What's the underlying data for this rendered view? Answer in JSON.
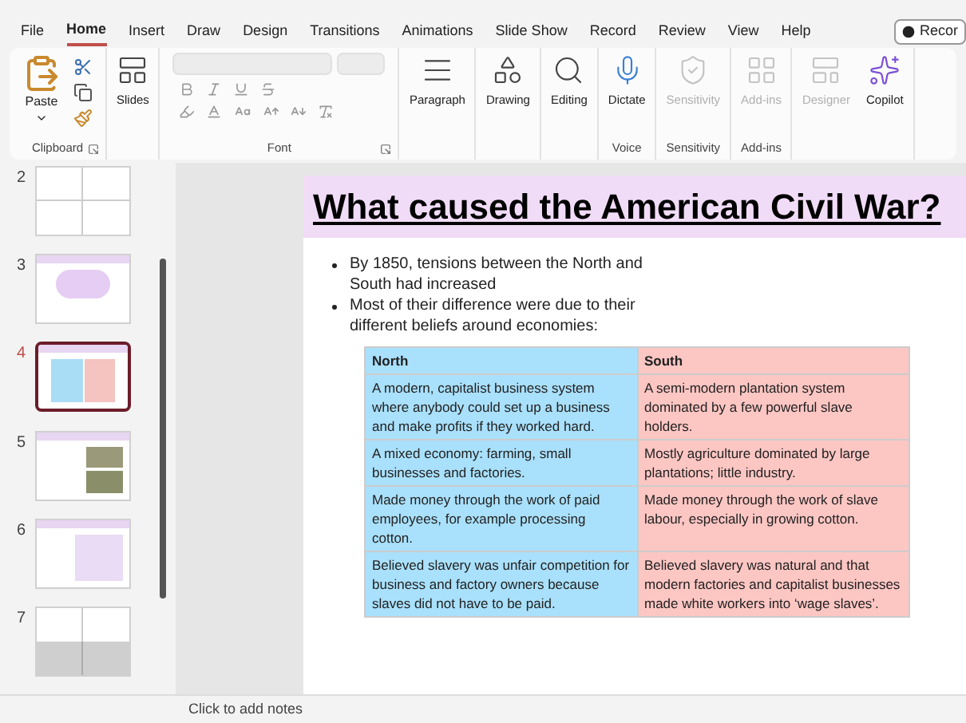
{
  "menu_tabs": [
    {
      "label": "File",
      "selected": false
    },
    {
      "label": "Home",
      "selected": true
    },
    {
      "label": "Insert",
      "selected": false
    },
    {
      "label": "Draw",
      "selected": false
    },
    {
      "label": "Design",
      "selected": false
    },
    {
      "label": "Transitions",
      "selected": false
    },
    {
      "label": "Animations",
      "selected": false
    },
    {
      "label": "Slide Show",
      "selected": false
    },
    {
      "label": "Record",
      "selected": false
    },
    {
      "label": "Review",
      "selected": false
    },
    {
      "label": "View",
      "selected": false
    },
    {
      "label": "Help",
      "selected": false
    }
  ],
  "record_button": {
    "label": "Recor"
  },
  "ribbon": [
    {
      "kind": "clipboard",
      "label": "Clipboard",
      "buttons": [
        {
          "label": "Paste",
          "disabled": false
        }
      ]
    },
    {
      "kind": "plain",
      "buttons": [
        {
          "kind": "slides",
          "label": "Slides",
          "disabled": false
        }
      ]
    },
    {
      "kind": "font",
      "label": "Font"
    },
    {
      "kind": "plain",
      "buttons": [
        {
          "kind": "paragraph",
          "label": "Paragraph",
          "disabled": false
        }
      ]
    },
    {
      "kind": "plain",
      "buttons": [
        {
          "kind": "drawing",
          "label": "Drawing",
          "disabled": false
        }
      ]
    },
    {
      "kind": "plain",
      "buttons": [
        {
          "kind": "editing",
          "label": "Editing",
          "disabled": false
        }
      ]
    },
    {
      "kind": "plain",
      "label": "Voice",
      "buttons": [
        {
          "kind": "dictate",
          "label": "Dictate",
          "disabled": false
        }
      ]
    },
    {
      "kind": "plain",
      "label": "Sensitivity",
      "buttons": [
        {
          "kind": "sensitivity",
          "label": "Sensitivity",
          "disabled": true
        }
      ]
    },
    {
      "kind": "plain",
      "label": "Add-ins",
      "buttons": [
        {
          "kind": "addins",
          "label": "Add-ins",
          "disabled": true
        }
      ]
    },
    {
      "kind": "plain",
      "buttons": [
        {
          "kind": "designer",
          "label": "Designer",
          "disabled": true
        },
        {
          "kind": "copilot",
          "label": "Copilot",
          "disabled": false
        }
      ]
    }
  ],
  "thumbnails": [
    {
      "number": "2",
      "kind": "grid",
      "selected": false
    },
    {
      "number": "3",
      "kind": "cloud",
      "selected": false
    },
    {
      "number": "4",
      "kind": "table",
      "selected": true
    },
    {
      "number": "5",
      "kind": "images",
      "selected": false
    },
    {
      "number": "6",
      "kind": "note",
      "selected": false
    },
    {
      "number": "7",
      "kind": "grey-grid",
      "selected": false
    }
  ],
  "slide": {
    "title": "What caused the American Civil War?",
    "bullets": [
      "By 1850, tensions between the North and South had increased",
      "Most of their difference were due to their different beliefs around economies:"
    ],
    "table": {
      "columns": [
        "North",
        "South"
      ],
      "rows": [
        [
          "A modern, capitalist business system where anybody could set up a business and make profits if they worked hard.",
          "A semi-modern plantation system dominated by a few powerful slave holders."
        ],
        [
          "A mixed economy: farming, small businesses and factories.",
          "Mostly agriculture dominated by large plantations; little industry."
        ],
        [
          "Made money through the work of paid employees, for example processing cotton.",
          "Made money through the work of slave labour, especially in growing cotton."
        ],
        [
          "Believed slavery was unfair competition for business and factory owners because slaves did not have to be paid.",
          "Believed slavery was natural and that modern factories and capitalist businesses made white workers into ‘wage slaves’."
        ]
      ]
    }
  },
  "notes": {
    "placeholder": "Click to add notes"
  }
}
